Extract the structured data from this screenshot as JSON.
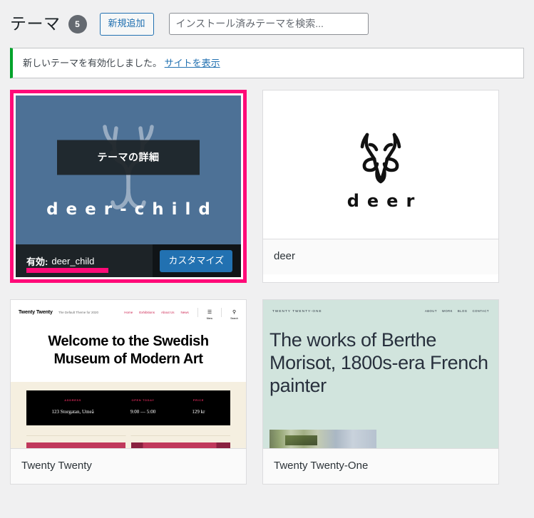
{
  "colors": {
    "accent_pink": "#ff0a78",
    "wp_blue": "#2271b1",
    "notice_green": "#00a32a",
    "badge_gray": "#646970",
    "dark_bar": "#1d2327",
    "deer_child_bg": "#4d7196",
    "tt21_bg": "#d1e4dd",
    "tt20_cream": "#f5efe0",
    "tt20_red": "#cd2653"
  },
  "header": {
    "title": "テーマ",
    "count": "5",
    "add_new_label": "新規追加",
    "search": {
      "value": "",
      "placeholder": "インストール済みテーマを検索..."
    }
  },
  "notice": {
    "message": "新しいテーマを有効化しました。",
    "link_label": "サイトを表示"
  },
  "themes": [
    {
      "id": "deer-child",
      "name": "deer-child",
      "is_active": true,
      "details_label": "テーマの詳細",
      "active_prefix": "有効:",
      "active_slug": "deer_child",
      "customize_label": "カスタマイズ",
      "screenshot": {
        "wordmark": "deer-child",
        "icon": "deer-antler-icon"
      }
    },
    {
      "id": "deer",
      "name": "deer",
      "is_active": false,
      "screenshot": {
        "wordmark": "deer",
        "icon": "deer-head-icon"
      }
    },
    {
      "id": "twentytwenty",
      "name": "Twenty Twenty",
      "is_active": false,
      "screenshot": {
        "brand": "Twenty Twenty",
        "tagline": "The Default Theme for 2020",
        "nav": [
          "Home",
          "Exhibitions",
          "About Us",
          "News"
        ],
        "menu_label": "Menu",
        "search_label": "Search",
        "hero_title": "Welcome to the Swedish Museum of Modern Art",
        "info": [
          {
            "label": "ADDRESS",
            "value": "123 Storgatan, Umeå"
          },
          {
            "label": "OPEN TODAY",
            "value": "9:00 — 5:00"
          },
          {
            "label": "PRICE",
            "value": "129 kr"
          }
        ]
      }
    },
    {
      "id": "twentytwentyone",
      "name": "Twenty Twenty-One",
      "is_active": false,
      "screenshot": {
        "brand": "TWENTY TWENTY-ONE",
        "nav": [
          "ABOUT",
          "WORK",
          "BLOG",
          "CONTACT"
        ],
        "hero_title": "The works of Berthe Morisot, 1800s-era French painter"
      }
    }
  ]
}
